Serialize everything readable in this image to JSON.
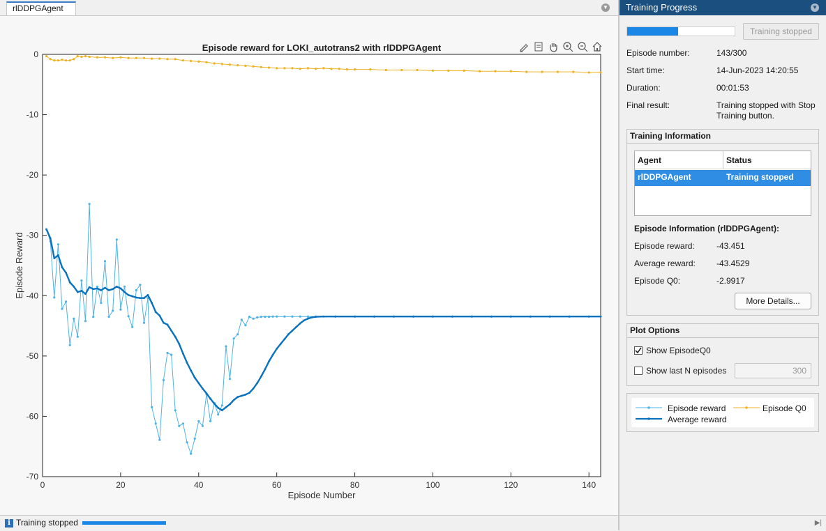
{
  "document": {
    "tab_label": "rlDDPGAgent",
    "status_text": "Training stopped"
  },
  "panel": {
    "title": "Training Progress",
    "progress": {
      "value": 143,
      "max": 300,
      "fraction": 0.4767
    },
    "stop_button": "Training stopped",
    "info": {
      "episode_number_label": "Episode number:",
      "episode_number_value": "143/300",
      "start_time_label": "Start time:",
      "start_time_value": "14-Jun-2023 14:20:55",
      "duration_label": "Duration:",
      "duration_value": "00:01:53",
      "final_result_label": "Final result:",
      "final_result_value_line1": "Training stopped with Stop",
      "final_result_value_line2": "Training button."
    },
    "training_information": {
      "title": "Training Information",
      "columns": [
        "Agent",
        "Status"
      ],
      "rows": [
        {
          "agent": "rlDDPGAgent",
          "status": "Training stopped"
        }
      ],
      "episode_info_title": "Episode Information (rlDDPGAgent):",
      "episode_reward_label": "Episode reward:",
      "episode_reward_value": "-43.451",
      "average_reward_label": "Average reward:",
      "average_reward_value": "-43.4529",
      "episode_q0_label": "Episode Q0:",
      "episode_q0_value": "-2.9917",
      "more_details_button": "More Details..."
    },
    "plot_options": {
      "title": "Plot Options",
      "show_q0_label": "Show EpisodeQ0",
      "show_q0_checked": true,
      "show_last_n_label": "Show last N episodes",
      "show_last_n_checked": false,
      "last_n_value": "300"
    },
    "legend": {
      "episode_reward": "Episode reward",
      "episode_q0": "Episode Q0",
      "average_reward": "Average reward"
    }
  },
  "colors": {
    "episode_reward": "#4db3e6",
    "average_reward": "#0a72bd",
    "episode_q0": "#edb120",
    "header": "#1b4f80",
    "progress": "#1a87e6"
  },
  "chart_data": {
    "type": "line",
    "title": "Episode reward for LOKI_autotrans2 with rlDDPGAgent",
    "xlabel": "Episode Number",
    "ylabel": "Episode Reward",
    "xlim": [
      0,
      143
    ],
    "ylim": [
      -70,
      0
    ],
    "xticks": [
      0,
      20,
      40,
      60,
      80,
      100,
      120,
      140
    ],
    "yticks": [
      0,
      -10,
      -20,
      -30,
      -40,
      -50,
      -60,
      -70
    ],
    "grid": false,
    "series": [
      {
        "name": "Episode reward",
        "points": [
          [
            1,
            -29
          ],
          [
            2,
            -31
          ],
          [
            3,
            -40.3
          ],
          [
            4,
            -31.5
          ],
          [
            5,
            -42.2
          ],
          [
            6,
            -41
          ],
          [
            7,
            -48.2
          ],
          [
            8,
            -43.8
          ],
          [
            9,
            -46.8
          ],
          [
            10,
            -37.5
          ],
          [
            11,
            -44.2
          ],
          [
            12,
            -24.8
          ],
          [
            13,
            -43.5
          ],
          [
            14,
            -38.5
          ],
          [
            15,
            -41.2
          ],
          [
            16,
            -34.3
          ],
          [
            17,
            -43.5
          ],
          [
            18,
            -42.5
          ],
          [
            19,
            -30.7
          ],
          [
            20,
            -42.3
          ],
          [
            21,
            -38.5
          ],
          [
            22,
            -43.4
          ],
          [
            23,
            -45.2
          ],
          [
            24,
            -39.1
          ],
          [
            25,
            -38.2
          ],
          [
            26,
            -44.5
          ],
          [
            27,
            -40.4
          ],
          [
            28,
            -58.5
          ],
          [
            29,
            -61.2
          ],
          [
            30,
            -63.9
          ],
          [
            31,
            -54
          ],
          [
            32,
            -49.5
          ],
          [
            33,
            -49.8
          ],
          [
            34,
            -59
          ],
          [
            35,
            -61.6
          ],
          [
            36,
            -61.2
          ],
          [
            37,
            -64.3
          ],
          [
            38,
            -66.2
          ],
          [
            39,
            -63.7
          ],
          [
            40,
            -60.8
          ],
          [
            41,
            -61.6
          ],
          [
            42,
            -56.3
          ],
          [
            43,
            -60.8
          ],
          [
            44,
            -57.8
          ],
          [
            45,
            -59.7
          ],
          [
            46,
            -58.2
          ],
          [
            47,
            -48.4
          ],
          [
            48,
            -53.8
          ],
          [
            49,
            -47.1
          ],
          [
            50,
            -46.4
          ],
          [
            51,
            -44
          ],
          [
            52,
            -44.9
          ],
          [
            53,
            -43.5
          ],
          [
            54,
            -43.8
          ],
          [
            55,
            -43.6
          ],
          [
            56,
            -43.5
          ],
          [
            57,
            -43.5
          ],
          [
            58,
            -43.5
          ],
          [
            59,
            -43.45
          ],
          [
            60,
            -43.45
          ],
          [
            62,
            -43.45
          ],
          [
            64,
            -43.45
          ],
          [
            66,
            -43.45
          ],
          [
            68,
            -43.45
          ],
          [
            70,
            -43.45
          ],
          [
            75,
            -43.45
          ],
          [
            80,
            -43.45
          ],
          [
            85,
            -43.45
          ],
          [
            90,
            -43.45
          ],
          [
            95,
            -43.45
          ],
          [
            100,
            -43.45
          ],
          [
            105,
            -43.45
          ],
          [
            110,
            -43.45
          ],
          [
            115,
            -43.45
          ],
          [
            120,
            -43.45
          ],
          [
            125,
            -43.45
          ],
          [
            130,
            -43.45
          ],
          [
            135,
            -43.45
          ],
          [
            140,
            -43.45
          ],
          [
            143,
            -43.45
          ]
        ]
      },
      {
        "name": "Average reward",
        "points": [
          [
            1,
            -29
          ],
          [
            2,
            -30.5
          ],
          [
            3,
            -33.8
          ],
          [
            4,
            -33.3
          ],
          [
            5,
            -35.3
          ],
          [
            6,
            -36.2
          ],
          [
            7,
            -37.8
          ],
          [
            8,
            -38.5
          ],
          [
            9,
            -39.4
          ],
          [
            10,
            -39.2
          ],
          [
            11,
            -39.7
          ],
          [
            12,
            -38.6
          ],
          [
            13,
            -38.9
          ],
          [
            14,
            -38.8
          ],
          [
            15,
            -39.1
          ],
          [
            16,
            -38.7
          ],
          [
            17,
            -39.1
          ],
          [
            18,
            -38.9
          ],
          [
            19,
            -38.5
          ],
          [
            20,
            -38.8
          ],
          [
            21,
            -39.4
          ],
          [
            22,
            -39.9
          ],
          [
            23,
            -40.1
          ],
          [
            24,
            -40.3
          ],
          [
            25,
            -40.4
          ],
          [
            26,
            -40.4
          ],
          [
            27,
            -39.9
          ],
          [
            28,
            -41.2
          ],
          [
            29,
            -42.7
          ],
          [
            30,
            -43.3
          ],
          [
            31,
            -44.5
          ],
          [
            32,
            -44.8
          ],
          [
            33,
            -45.8
          ],
          [
            34,
            -46.8
          ],
          [
            35,
            -48
          ],
          [
            36,
            -49.6
          ],
          [
            37,
            -51.1
          ],
          [
            38,
            -52.4
          ],
          [
            39,
            -53.6
          ],
          [
            40,
            -54.5
          ],
          [
            41,
            -55.4
          ],
          [
            42,
            -56.2
          ],
          [
            43,
            -57.1
          ],
          [
            44,
            -57.9
          ],
          [
            45,
            -58.6
          ],
          [
            46,
            -59
          ],
          [
            47,
            -58.5
          ],
          [
            48,
            -58
          ],
          [
            49,
            -57.3
          ],
          [
            50,
            -56.8
          ],
          [
            51,
            -56.6
          ],
          [
            52,
            -56.4
          ],
          [
            53,
            -56.1
          ],
          [
            54,
            -55.4
          ],
          [
            55,
            -54.5
          ],
          [
            56,
            -53.4
          ],
          [
            57,
            -52.2
          ],
          [
            58,
            -50.9
          ],
          [
            59,
            -49.8
          ],
          [
            60,
            -48.8
          ],
          [
            61,
            -48
          ],
          [
            62,
            -47.2
          ],
          [
            63,
            -46.4
          ],
          [
            64,
            -45.8
          ],
          [
            65,
            -45.2
          ],
          [
            66,
            -44.6
          ],
          [
            67,
            -44.1
          ],
          [
            68,
            -43.8
          ],
          [
            69,
            -43.6
          ],
          [
            70,
            -43.5
          ],
          [
            72,
            -43.45
          ],
          [
            75,
            -43.45
          ],
          [
            80,
            -43.45
          ],
          [
            85,
            -43.45
          ],
          [
            90,
            -43.45
          ],
          [
            95,
            -43.45
          ],
          [
            100,
            -43.45
          ],
          [
            105,
            -43.45
          ],
          [
            110,
            -43.45
          ],
          [
            115,
            -43.45
          ],
          [
            120,
            -43.45
          ],
          [
            125,
            -43.45
          ],
          [
            130,
            -43.45
          ],
          [
            135,
            -43.45
          ],
          [
            140,
            -43.45
          ],
          [
            143,
            -43.45
          ]
        ]
      },
      {
        "name": "Episode Q0",
        "points": [
          [
            1,
            -0.3
          ],
          [
            2,
            -0.8
          ],
          [
            3,
            -1
          ],
          [
            4,
            -1
          ],
          [
            5,
            -0.9
          ],
          [
            6,
            -1
          ],
          [
            7,
            -1
          ],
          [
            8,
            -0.8
          ],
          [
            9,
            -0.3
          ],
          [
            10,
            -0.4
          ],
          [
            11,
            -0.3
          ],
          [
            12,
            -0.4
          ],
          [
            14,
            -0.5
          ],
          [
            16,
            -0.5
          ],
          [
            18,
            -0.6
          ],
          [
            20,
            -0.5
          ],
          [
            22,
            -0.6
          ],
          [
            24,
            -0.6
          ],
          [
            26,
            -0.6
          ],
          [
            28,
            -0.7
          ],
          [
            30,
            -0.7
          ],
          [
            32,
            -0.8
          ],
          [
            34,
            -0.8
          ],
          [
            36,
            -1
          ],
          [
            38,
            -1.1
          ],
          [
            40,
            -1.2
          ],
          [
            42,
            -1.3
          ],
          [
            44,
            -1.5
          ],
          [
            46,
            -1.6
          ],
          [
            48,
            -1.7
          ],
          [
            50,
            -1.8
          ],
          [
            52,
            -1.9
          ],
          [
            54,
            -2
          ],
          [
            56,
            -2.1
          ],
          [
            58,
            -2.2
          ],
          [
            60,
            -2.3
          ],
          [
            62,
            -2.3
          ],
          [
            64,
            -2.3
          ],
          [
            66,
            -2.4
          ],
          [
            68,
            -2.3
          ],
          [
            70,
            -2.4
          ],
          [
            72,
            -2.3
          ],
          [
            74,
            -2.4
          ],
          [
            76,
            -2.4
          ],
          [
            78,
            -2.5
          ],
          [
            80,
            -2.5
          ],
          [
            84,
            -2.5
          ],
          [
            88,
            -2.6
          ],
          [
            92,
            -2.6
          ],
          [
            96,
            -2.6
          ],
          [
            100,
            -2.7
          ],
          [
            104,
            -2.7
          ],
          [
            108,
            -2.7
          ],
          [
            112,
            -2.8
          ],
          [
            116,
            -2.8
          ],
          [
            120,
            -2.8
          ],
          [
            124,
            -2.9
          ],
          [
            128,
            -2.9
          ],
          [
            132,
            -2.9
          ],
          [
            136,
            -2.9
          ],
          [
            140,
            -3
          ],
          [
            143,
            -2.99
          ]
        ]
      }
    ]
  }
}
